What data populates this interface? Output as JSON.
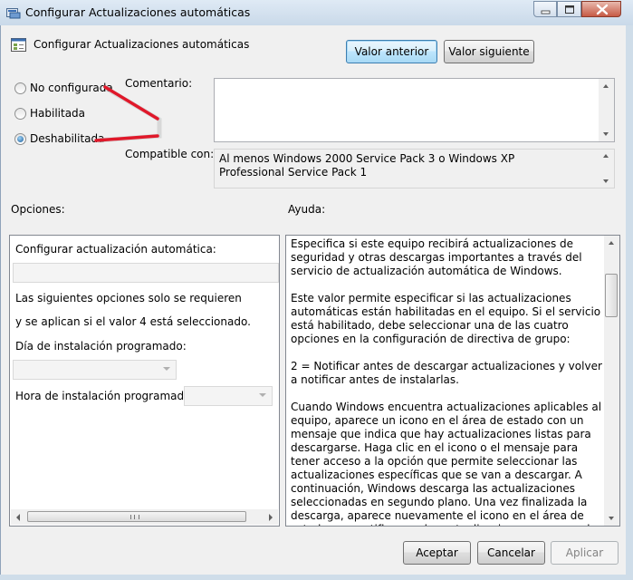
{
  "window": {
    "title": "Configurar Actualizaciones automáticas"
  },
  "header": {
    "setting_title": "Configurar Actualizaciones automáticas",
    "prev_button": "Valor anterior",
    "next_button": "Valor siguiente"
  },
  "state": {
    "options": [
      {
        "label": "No configurada",
        "checked": false
      },
      {
        "label": "Habilitada",
        "checked": false
      },
      {
        "label": "Deshabilitada",
        "checked": true
      }
    ]
  },
  "comment": {
    "label": "Comentario:",
    "value": ""
  },
  "supported": {
    "label": "Compatible con:",
    "value": "Al menos Windows 2000 Service Pack 3 o Windows XP Professional Service Pack 1"
  },
  "options_panel": {
    "label": "Opciones:",
    "configure_label": "Configurar actualización automática:",
    "note_line1": "Las siguientes opciones solo se requieren",
    "note_line2": "y se aplican si el valor 4 está seleccionado.",
    "install_day_label": "Día de instalación programado:",
    "install_time_label": "Hora de instalación programada:"
  },
  "help_panel": {
    "label": "Ayuda:",
    "paragraphs": [
      "Especifica si este equipo recibirá actualizaciones de seguridad y otras descargas importantes a través del servicio de actualización automática de Windows.",
      "Este valor permite especificar si las actualizaciones automáticas están habilitadas en el equipo. Si el servicio está habilitado, debe seleccionar una de las cuatro opciones en la configuración de directiva de grupo:",
      "2 = Notificar antes de descargar actualizaciones y volver a notificar antes de instalarlas.",
      "Cuando Windows encuentra actualizaciones aplicables al equipo, aparece un icono en el área de estado con un mensaje que indica que hay actualizaciones listas para descargarse. Haga clic en el icono o el mensaje para tener acceso a la opción que permite seleccionar las actualizaciones específicas que se van a descargar. A continuación, Windows descarga las actualizaciones seleccionadas en segundo plano. Una vez finalizada la descarga, aparece nuevamente el icono en el área de estado y se notifica que las actualizaciones ya se pueden instalar. Haga clic en el"
    ]
  },
  "footer": {
    "ok": "Aceptar",
    "cancel": "Cancelar",
    "apply": "Aplicar"
  },
  "colors": {
    "annotation_arrow": "#e0182a",
    "focus_button": "#3c7fb1"
  },
  "icons": [
    "policy-icon",
    "minimize-icon",
    "maximize-icon",
    "close-icon",
    "settings-icon"
  ]
}
